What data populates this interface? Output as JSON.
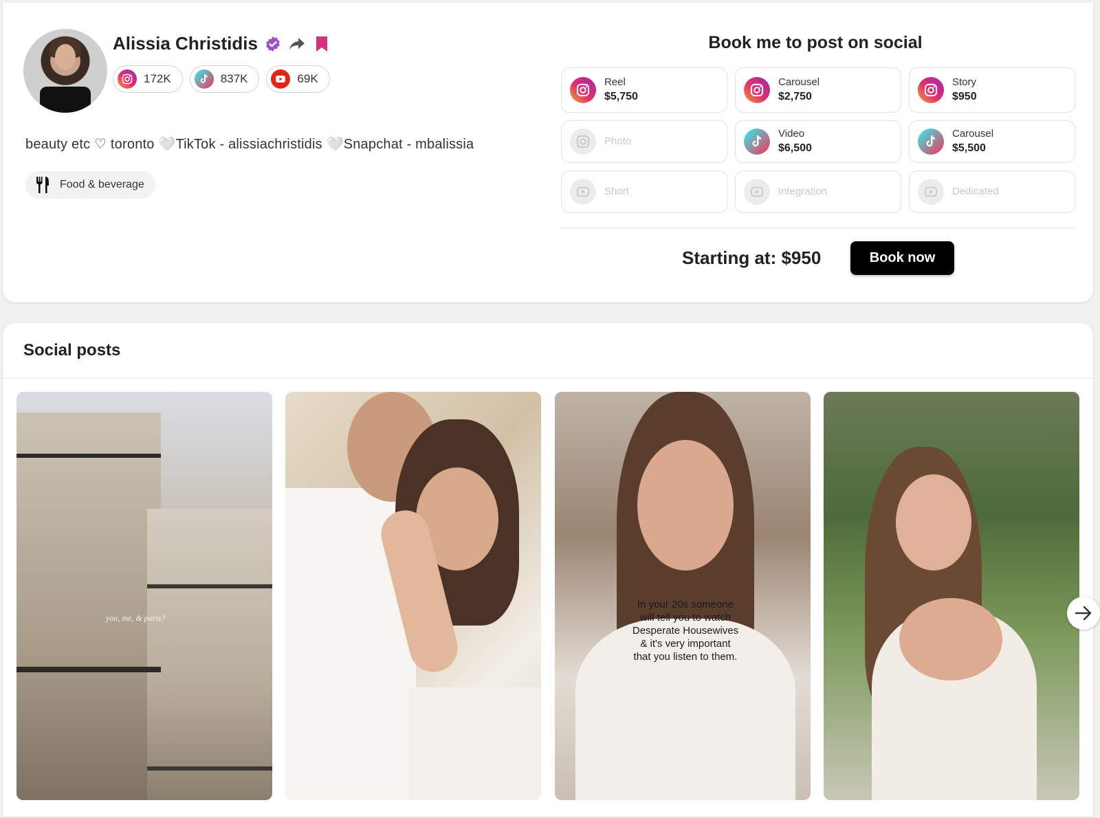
{
  "profile": {
    "name": "Alissia Christidis",
    "stats": [
      {
        "platform": "instagram",
        "icon": "instagram-icon",
        "value": "172K"
      },
      {
        "platform": "tiktok",
        "icon": "tiktok-icon",
        "value": "837K"
      },
      {
        "platform": "youtube",
        "icon": "youtube-icon",
        "value": "69K"
      }
    ],
    "bio": "beauty etc ♡ toronto 🤍TikTok - alissiachristidis 🤍Snapchat - mbalissia",
    "category": "Food & beverage",
    "accent_color": "#c2307a"
  },
  "booking": {
    "title": "Book me to post on social",
    "offers": [
      {
        "platform": "instagram",
        "label": "Reel",
        "price": "$5,750",
        "enabled": true
      },
      {
        "platform": "instagram",
        "label": "Carousel",
        "price": "$2,750",
        "enabled": true
      },
      {
        "platform": "instagram",
        "label": "Story",
        "price": "$950",
        "enabled": true
      },
      {
        "platform": "instagram",
        "label": "Photo",
        "price": "",
        "enabled": false
      },
      {
        "platform": "tiktok",
        "label": "Video",
        "price": "$6,500",
        "enabled": true
      },
      {
        "platform": "tiktok",
        "label": "Carousel",
        "price": "$5,500",
        "enabled": true
      },
      {
        "platform": "youtube",
        "label": "Short",
        "price": "",
        "enabled": false
      },
      {
        "platform": "youtube",
        "label": "Integration",
        "price": "",
        "enabled": false
      },
      {
        "platform": "youtube",
        "label": "Dedicated",
        "price": "",
        "enabled": false
      }
    ],
    "starting_at": "Starting at: $950",
    "book_button": "Book now"
  },
  "posts": {
    "title": "Social posts",
    "items": [
      {
        "overlay": "you, me, & paris?"
      },
      {
        "overlay": ""
      },
      {
        "overlay": "In your 20s someone will tell you to watch Desperate Housewives & it's very important that you listen to them."
      },
      {
        "overlay": ""
      }
    ]
  }
}
